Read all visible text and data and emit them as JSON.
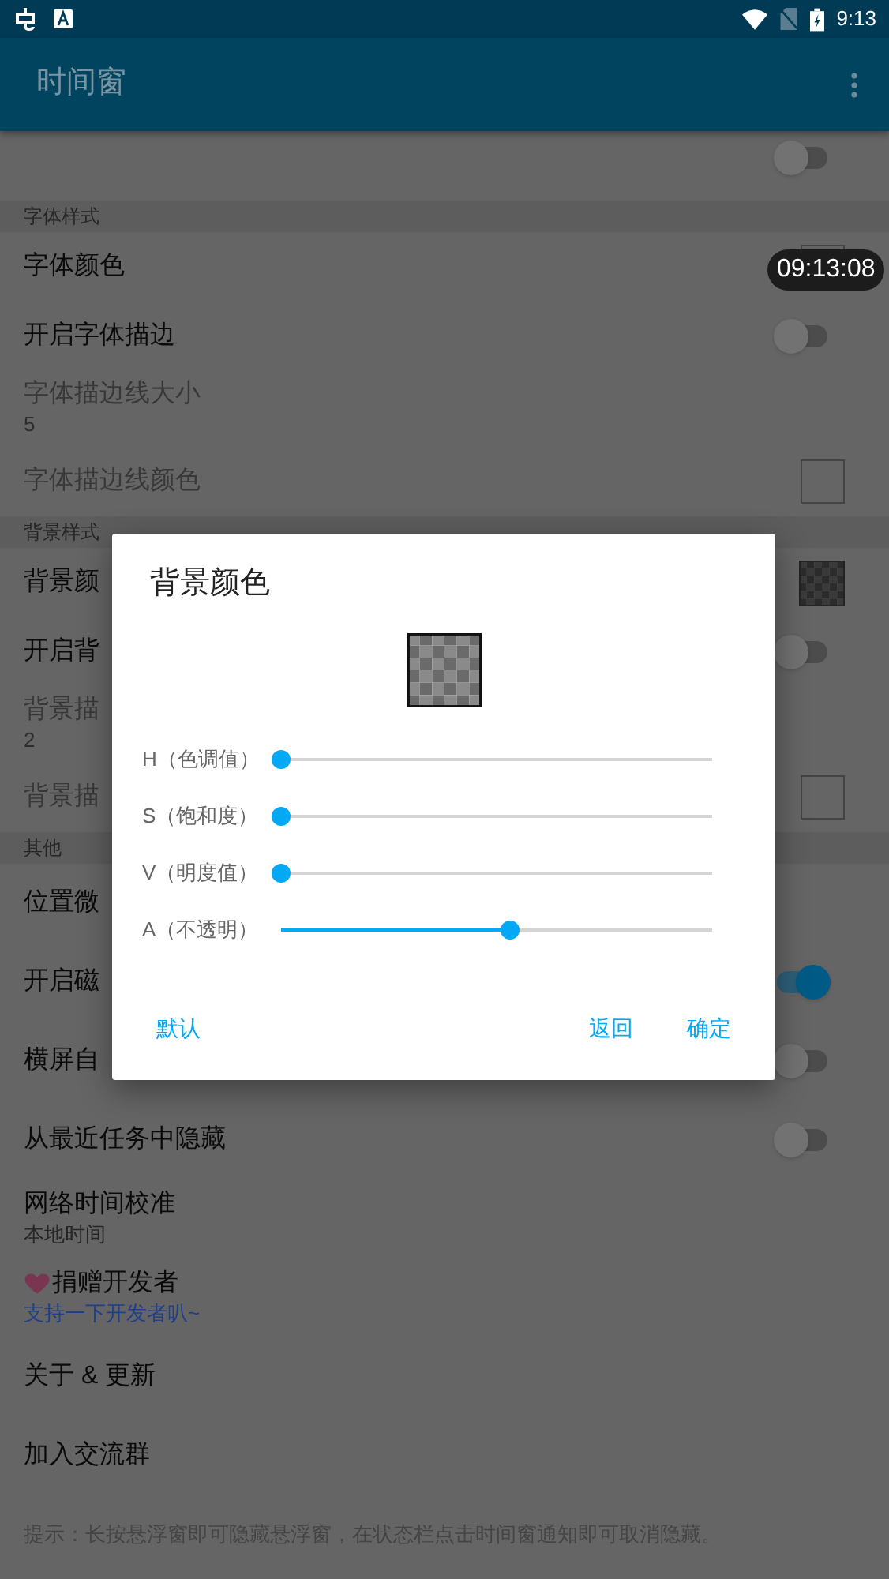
{
  "status_bar": {
    "time": "9:13"
  },
  "app_bar": {
    "title": "时间窗"
  },
  "sections": [
    {
      "items": [
        {
          "kind": "switch",
          "on": false
        }
      ]
    },
    {
      "header": "字体样式",
      "items": [
        {
          "kind": "color",
          "title": "字体颜色",
          "checkered": false,
          "disabled": false
        },
        {
          "kind": "switch",
          "title": "开启字体描边",
          "on": false,
          "disabled": false
        },
        {
          "kind": "value",
          "title": "字体描边线大小",
          "subtitle": "5",
          "disabled": true
        },
        {
          "kind": "color",
          "title": "字体描边线颜色",
          "checkered": false,
          "disabled": true
        }
      ]
    },
    {
      "header": "背景样式",
      "items": [
        {
          "kind": "color",
          "title": "背景颜",
          "checkered": true,
          "disabled": false
        },
        {
          "kind": "switch",
          "title": "开启背",
          "on": false,
          "disabled": false
        },
        {
          "kind": "value",
          "title": "背景描",
          "subtitle": "2",
          "disabled": true
        },
        {
          "kind": "color",
          "title": "背景描",
          "checkered": false,
          "disabled": true
        }
      ]
    },
    {
      "header": "其他",
      "items": [
        {
          "kind": "plain",
          "title": "位置微",
          "disabled": false
        },
        {
          "kind": "switch",
          "title": "开启磁",
          "on": true,
          "disabled": false
        },
        {
          "kind": "switch",
          "title": "横屏自",
          "on": false,
          "disabled": false
        },
        {
          "kind": "switch",
          "title": "从最近任务中隐藏",
          "on": false,
          "disabled": false
        },
        {
          "kind": "value",
          "title": "网络时间校准",
          "subtitle": "本地时间",
          "disabled": false
        },
        {
          "kind": "donate",
          "title": "捐赠开发者",
          "subtitle": "支持一下开发者叭~",
          "disabled": false
        },
        {
          "kind": "plain",
          "title": "关于 & 更新",
          "disabled": false
        },
        {
          "kind": "plain",
          "title": "加入交流群",
          "disabled": false
        },
        {
          "kind": "note",
          "title": "提示：长按悬浮窗即可隐藏悬浮窗，在状态栏点击时间窗通知即可取消隐藏。"
        }
      ]
    }
  ],
  "floating_clock": "09:13:08",
  "dialog": {
    "title": "背景颜色",
    "checkered": true,
    "sliders": [
      {
        "label": "H（色调值）",
        "level": 0
      },
      {
        "label": "S（饱和度）",
        "level": 0
      },
      {
        "label": "V（明度值）",
        "level": 0
      },
      {
        "label": "A（不透明）",
        "level": 0.53
      }
    ],
    "left_buttons": [
      "默认"
    ],
    "right_buttons": [
      "返回",
      "确定"
    ]
  }
}
